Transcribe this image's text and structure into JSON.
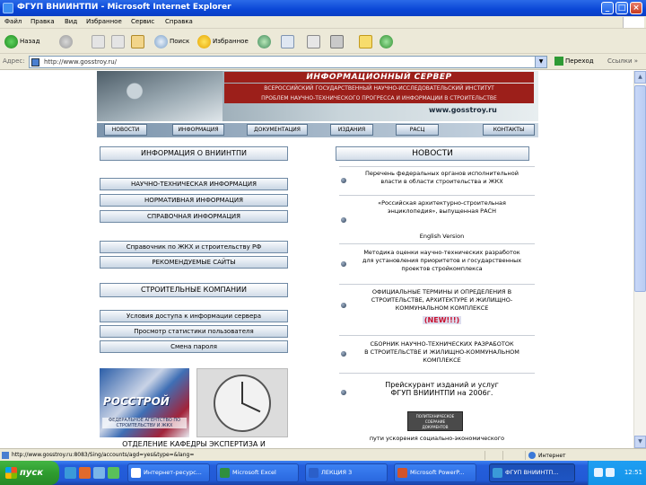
{
  "window": {
    "title": "ФГУП ВНИИНТПИ - Microsoft Internet Explorer",
    "minimize": "_",
    "maximize": "□",
    "close": "×"
  },
  "menu": [
    "Файл",
    "Правка",
    "Вид",
    "Избранное",
    "Сервис",
    "Справка"
  ],
  "toolbar": {
    "back": "Назад",
    "search": "Поиск",
    "favorites": "Избранное"
  },
  "address": {
    "label": "Адрес:",
    "url": "http://www.gosstroy.ru/",
    "go": "Переход",
    "links": "Ссылки",
    "links_arrow": "»"
  },
  "banner": {
    "server": "ИНФОРМАЦИОННЫЙ СЕРВЕР",
    "institute": "ВСЕРОССИЙСКИЙ ГОСУДАРСТВЕННЫЙ НАУЧНО-ИССЛЕДОВАТЕЛЬСКИЙ ИНСТИТУТ\nПРОБЛЕМ НАУЧНО-ТЕХНИЧЕСКОГО ПРОГРЕССА И ИНФОРМАЦИИ В СТРОИТЕЛЬСТВЕ",
    "www": "www.gosstroy.ru"
  },
  "nav": [
    "НОВОСТИ",
    "ИНФОРМАЦИЯ",
    "ДОКУМЕНТАЦИЯ",
    "ИЗДАНИЯ",
    "РАСЦ",
    "КОНТАКТЫ"
  ],
  "left": {
    "heading": "ИНФОРМАЦИЯ О ВНИИНТПИ",
    "group1": [
      "НАУЧНО-ТЕХНИЧЕСКАЯ ИНФОРМАЦИЯ",
      "НОРМАТИВНАЯ ИНФОРМАЦИЯ",
      "СПРАВОЧНАЯ ИНФОРМАЦИЯ"
    ],
    "group2": [
      "Справочник по ЖКХ и строительству РФ",
      "РЕКОМЕНДУЕМЫЕ САЙТЫ"
    ],
    "companies": "СТРОИТЕЛЬНЫЕ КОМПАНИИ",
    "group3": [
      "Условия доступа к информации сервера",
      "Просмотр статистики пользователя",
      "Смена пароля"
    ],
    "logo_text": "РОССТРОЙ",
    "logo_sub": "ФЕДЕРАЛЬНОЕ АГЕНТСТВО ПО СТРОИТЕЛЬСТВУ И ЖКХ",
    "dept": "ОТДЕЛЕНИЕ КАФЕДРЫ ЭКСПЕРТИЗА И"
  },
  "news": {
    "heading": "НОВОСТИ",
    "items": [
      "Перечень федеральных органов исполнительной\nвласти в области строительства и ЖКХ",
      "«Российская архитектурно-строительная\nэнциклопедия», выпущенная РАСН",
      "English Version",
      "Методика оценки научно-технических разработок\nдля установления приоритетов и государственных\nпроектов стройкомплекса",
      "ОФИЦИАЛЬНЫЕ ТЕРМИНЫ И ОПРЕДЕЛЕНИЯ В\nСТРОИТЕЛЬСТВЕ, АРХИТЕКТУРЕ И ЖИЛИЩНО-\nКОММУНАЛЬНОМ КОМПЛЕКСЕ",
      "СБОРНИК НАУЧНО-ТЕХНИЧЕСКИХ РАЗРАБОТОК\nВ СТРОИТЕЛЬСТВЕ И ЖИЛИЩНО-КОММУНАЛЬНОМ\nКОМПЛЕКСЕ",
      "Прейскурант изданий и услуг\nФГУП ВНИИНТПИ на 2006г."
    ],
    "new_label": "(NEW!!!)",
    "badge": "ПОЛИТЕХНИЧЕСКОЕ\nСОБРАНИЕ\nДОКУМЕНТОВ",
    "more": "пути ускорения социально-экономического"
  },
  "status": {
    "text": "http://www.gosstroy.ru:8083/Sing/accounts/agd=yes&type=&lang=",
    "zone": "Интернет"
  },
  "taskbar": {
    "start": "пуск",
    "tasks": [
      "Интернет-ресурс...",
      "Microsoft Excel",
      "ЛЕКЦИЯ 3",
      "Microsoft PowerP...",
      "ФГУП ВНИИНТП..."
    ],
    "clock": "12:51"
  }
}
